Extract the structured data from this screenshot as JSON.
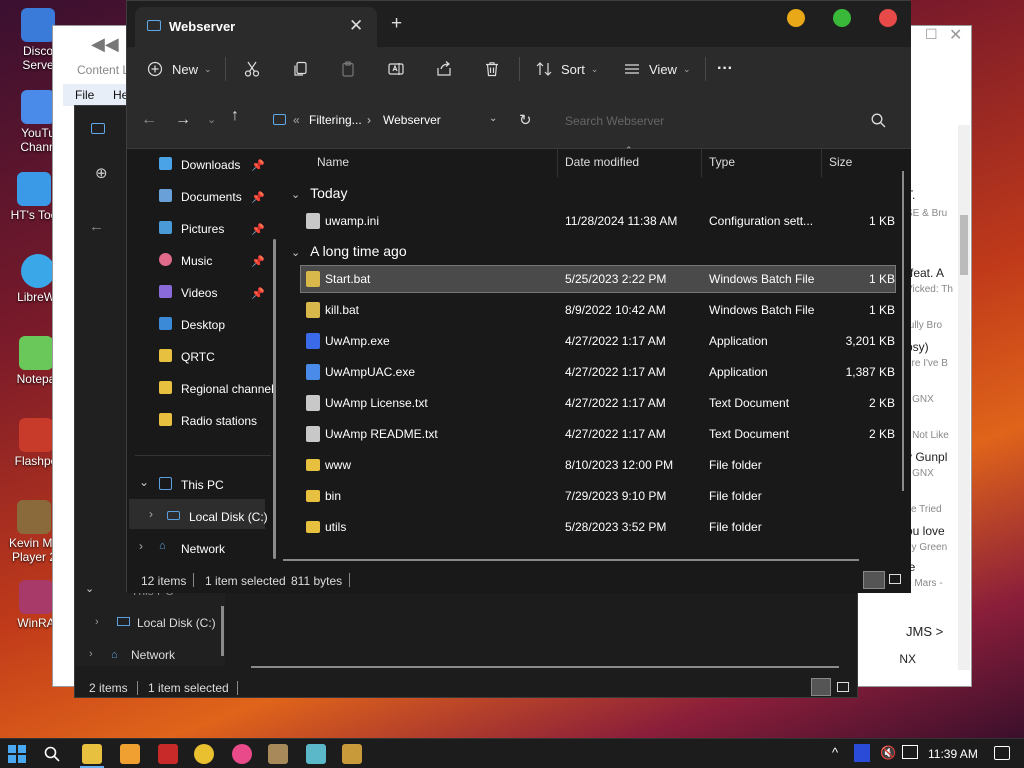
{
  "desktop": {
    "icons": [
      {
        "label": "Disco Serve"
      },
      {
        "label": "YouTu Chann"
      },
      {
        "label": "HT's Too"
      },
      {
        "label": "LibreWr"
      },
      {
        "label": "Notepa"
      },
      {
        "label": "Flashpo"
      },
      {
        "label": "Kevin Me Player 2"
      },
      {
        "label": "WinRA"
      }
    ]
  },
  "background_app": {
    "title": "Content L",
    "menu": [
      "File",
      "He"
    ],
    "right_panel": [
      {
        "text": "T.",
        "sub": false
      },
      {
        "text": "SE & Bru",
        "sub": true
      },
      {
        "text": "(feat. A",
        "sub": false
      },
      {
        "text": "Vicked: Th",
        "sub": true
      },
      {
        "text": "fully Bro",
        "sub": true
      },
      {
        "text": "psy)",
        "sub": false
      },
      {
        "text": "ere I've B",
        "sub": true
      },
      {
        "text": "- GNX",
        "sub": true
      },
      {
        "text": "- Not Like",
        "sub": true
      },
      {
        "text": "y Gunpl",
        "sub": false
      },
      {
        "text": "- GNX",
        "sub": true
      },
      {
        "text": "ve Tried",
        "sub": true
      },
      {
        "text": "ou love",
        "sub": false
      },
      {
        "text": "ey Green",
        "sub": true
      },
      {
        "text": "le",
        "sub": false
      },
      {
        "text": "o Mars -",
        "sub": true
      },
      {
        "text": "JMS >",
        "sub": false
      },
      {
        "text": "GNX",
        "sub": false
      }
    ]
  },
  "back_explorer": {
    "nav": [
      "This PC",
      "Local Disk (C:)",
      "Network"
    ],
    "status": {
      "count": "2 items",
      "selected": "1 item selected"
    }
  },
  "explorer": {
    "tab_title": "Webserver",
    "toolbar": {
      "new_label": "New",
      "sort_label": "Sort",
      "view_label": "View",
      "more_label": "···"
    },
    "breadcrumb": {
      "overflow": "«",
      "parent": "Filtering...",
      "current": "Webserver"
    },
    "search_placeholder": "Search Webserver",
    "nav": {
      "quick": [
        {
          "label": "Downloads",
          "pinned": true,
          "color": "#4aa3e6"
        },
        {
          "label": "Documents",
          "pinned": true,
          "color": "#6aa0d8"
        },
        {
          "label": "Pictures",
          "pinned": true,
          "color": "#4a9ad8"
        },
        {
          "label": "Music",
          "pinned": true,
          "color": "#e06a8a"
        },
        {
          "label": "Videos",
          "pinned": true,
          "color": "#8a6ad8"
        },
        {
          "label": "Desktop",
          "pinned": false,
          "color": "#3a8ad8"
        },
        {
          "label": "QRTC",
          "pinned": false,
          "color": "#e8c040"
        },
        {
          "label": "Regional channels",
          "pinned": false,
          "color": "#e8c040"
        },
        {
          "label": "Radio stations",
          "pinned": false,
          "color": "#e8c040"
        }
      ],
      "this_pc": "This PC",
      "local_disk": "Local Disk (C:)",
      "network": "Network"
    },
    "columns": {
      "name": "Name",
      "date": "Date modified",
      "type": "Type",
      "size": "Size"
    },
    "groups": {
      "today": "Today",
      "long_ago": "A long time ago"
    },
    "files_today": [
      {
        "name": "uwamp.ini",
        "date": "11/28/2024 11:38 AM",
        "type": "Configuration sett...",
        "size": "1 KB",
        "icon": "#c8c8c8"
      }
    ],
    "files_old": [
      {
        "name": "Start.bat",
        "date": "5/25/2023 2:22 PM",
        "type": "Windows Batch File",
        "size": "1 KB",
        "icon": "#d8b84a",
        "selected": true
      },
      {
        "name": "kill.bat",
        "date": "8/9/2022 10:42 AM",
        "type": "Windows Batch File",
        "size": "1 KB",
        "icon": "#d8b84a",
        "selected": false
      },
      {
        "name": "UwAmp.exe",
        "date": "4/27/2022 1:17 AM",
        "type": "Application",
        "size": "3,201 KB",
        "icon": "#3a6ae8",
        "selected": false
      },
      {
        "name": "UwAmpUAC.exe",
        "date": "4/27/2022 1:17 AM",
        "type": "Application",
        "size": "1,387 KB",
        "icon": "#4a8ae8",
        "selected": false
      },
      {
        "name": "UwAmp License.txt",
        "date": "4/27/2022 1:17 AM",
        "type": "Text Document",
        "size": "2 KB",
        "icon": "#c8c8c8",
        "selected": false
      },
      {
        "name": "UwAmp README.txt",
        "date": "4/27/2022 1:17 AM",
        "type": "Text Document",
        "size": "2 KB",
        "icon": "#c8c8c8",
        "selected": false
      },
      {
        "name": "www",
        "date": "8/10/2023 12:00 PM",
        "type": "File folder",
        "size": "",
        "icon": "#e8c040",
        "selected": false
      },
      {
        "name": "bin",
        "date": "7/29/2023 9:10 PM",
        "type": "File folder",
        "size": "",
        "icon": "#e8c040",
        "selected": false
      },
      {
        "name": "utils",
        "date": "5/28/2023 3:52 PM",
        "type": "File folder",
        "size": "",
        "icon": "#e8c040",
        "selected": false
      }
    ],
    "status": {
      "count": "12 items",
      "selected": "1 item selected",
      "size": "811 bytes"
    }
  },
  "taskbar": {
    "time": "11:39 AM"
  }
}
